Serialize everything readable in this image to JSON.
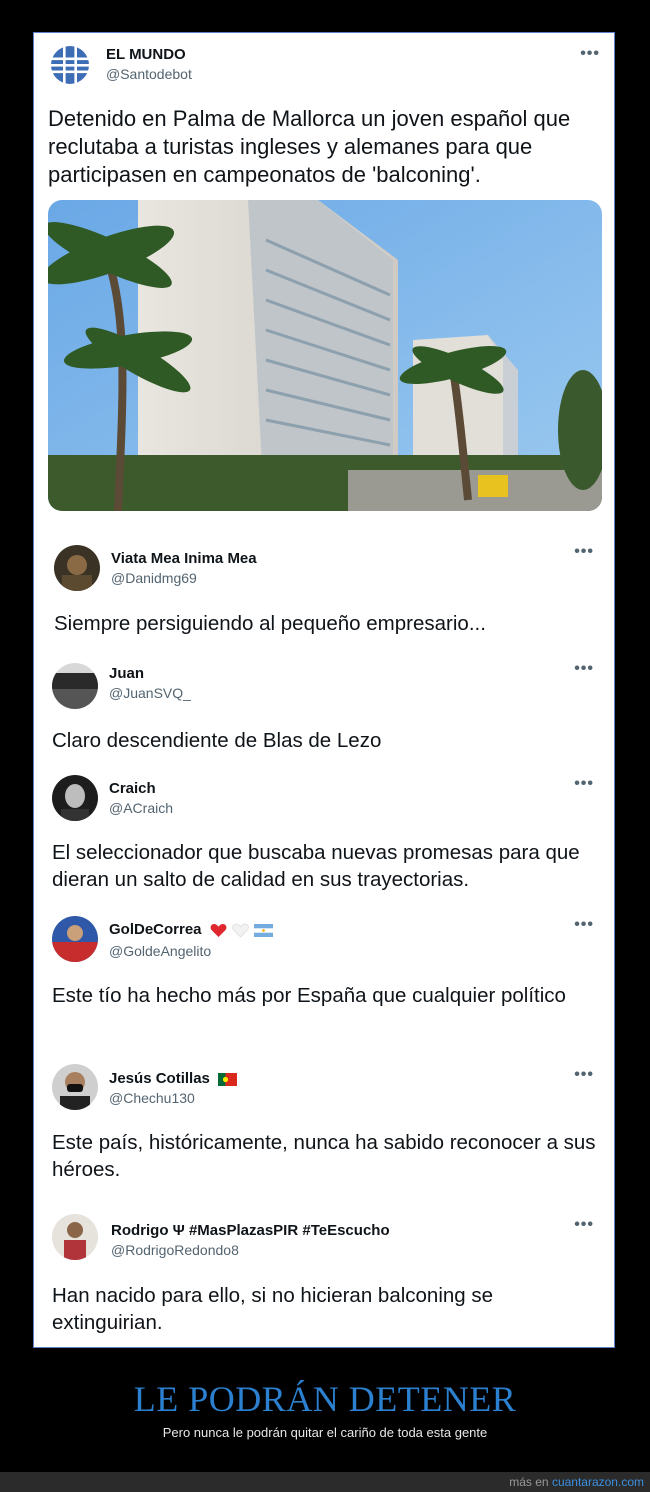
{
  "main_tweet": {
    "name": "EL MUNDO",
    "handle": "@Santodebot",
    "more": "•••",
    "text": "Detenido en Palma de Mallorca un joven español que reclutaba a turistas ingleses y alemanes para que participasen en campeonatos de 'balconing'."
  },
  "replies": [
    {
      "name": "Viata Mea Inima Mea",
      "handle": "@Danidmg69",
      "more": "•••",
      "text": "Siempre persiguiendo al pequeño empresario..."
    },
    {
      "name": "Juan",
      "handle": "@JuanSVQ_",
      "more": "•••",
      "text": "Claro descendiente de Blas de Lezo"
    },
    {
      "name": "Craich",
      "handle": "@ACraich",
      "more": "•••",
      "text": "El seleccionador que buscaba nuevas promesas para que dieran un salto de calidad en sus trayectorias."
    },
    {
      "name": "GolDeCorrea",
      "handle": "@GoldeAngelito",
      "more": "•••",
      "text": "Este tío ha hecho más por España que cualquier político"
    },
    {
      "name": "Jesús Cotillas",
      "handle": "@Chechu130",
      "more": "•••",
      "text": "Este país, históricamente, nunca ha sabido reconocer a sus héroes."
    },
    {
      "name": "Rodrigo Ψ #MasPlazasPIR #TeEscucho",
      "handle": "@RodrigoRedondo8",
      "more": "•••",
      "text": "Han nacido para ello, si no hicieran balconing se extinguirian."
    }
  ],
  "footer": {
    "title": "LE PODRÁN DETENER",
    "subtitle": "Pero nunca le podrán quitar el cariño de toda esta gente",
    "more_prefix": "más en",
    "site": "cuantarazon.com"
  },
  "colors": {
    "accent": "#2c80d0",
    "link": "#3b8fe0",
    "card_border": "#5b7fc8"
  },
  "icons": {
    "el_mundo_logo": "globe-logo",
    "more": "more-options-icon",
    "heart": "red-heart-emoji",
    "white_heart": "white-heart-emoji",
    "argentina_flag": "argentina-flag-emoji",
    "portugal_flag": "portugal-flag-emoji"
  }
}
